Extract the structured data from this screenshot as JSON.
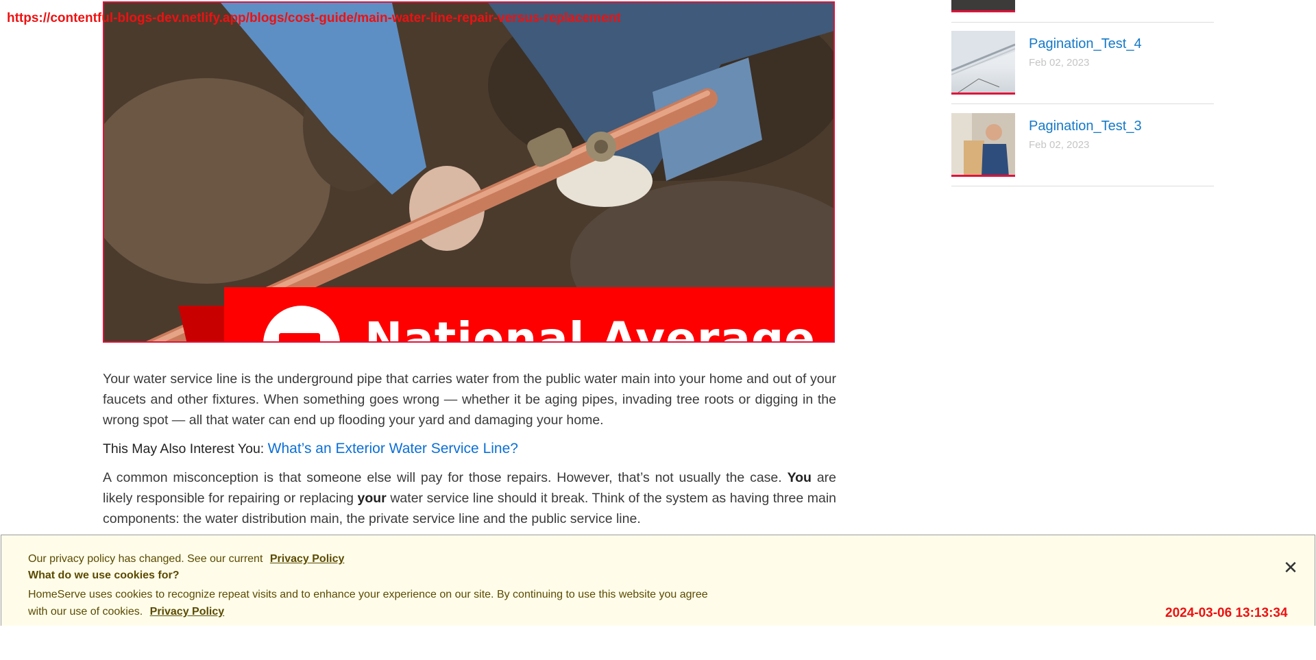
{
  "overlay": {
    "url": "https://contentful-blogs-dev.netlify.app/blogs/cost-guide/main-water-line-repair-versus-replacement",
    "timestamp": "2024-03-06 13:13:34"
  },
  "hero": {
    "banner_text": "National Average",
    "accent": "#ff0000",
    "border": "#e0123a"
  },
  "article": {
    "p1": "Your water service line is the underground pipe that carries water from the public water main into your home and out of your faucets and other fixtures. When something goes wrong — whether it be aging pipes, invading tree roots or digging in the wrong spot — all that water can end up flooding your yard and damaging your home.",
    "interest_label": "This May Also Interest You:",
    "interest_link": "What’s an Exterior Water Service Line?",
    "p2_a": "A common misconception is that someone else will pay for those repairs. However, that’s not usually the case.",
    "p2_you": "You",
    "p2_b": "are likely responsible for repairing or replacing",
    "p2_your": "your",
    "p2_c": "water service line should it break. Think of the system as having three main components: the water distribution main, the private service line and the public service line."
  },
  "sidebar": {
    "items": [
      {
        "title": "Pagination_Test_4",
        "date": "Feb 02, 2023",
        "thumb": "house-gutter-image"
      },
      {
        "title": "Pagination_Test_3",
        "date": "Feb 02, 2023",
        "thumb": "technician-image"
      }
    ]
  },
  "cookie": {
    "line1": "Our privacy policy has changed. See our current",
    "link1": "Privacy Policy",
    "heading": "What do we use cookies for?",
    "body": "HomeServe uses cookies to recognize repeat visits and to enhance your experience on our site. By continuing to use this website you agree with our use of cookies.",
    "link2": "Privacy Policy",
    "close_icon": "close-icon",
    "background": "#fffdea"
  }
}
